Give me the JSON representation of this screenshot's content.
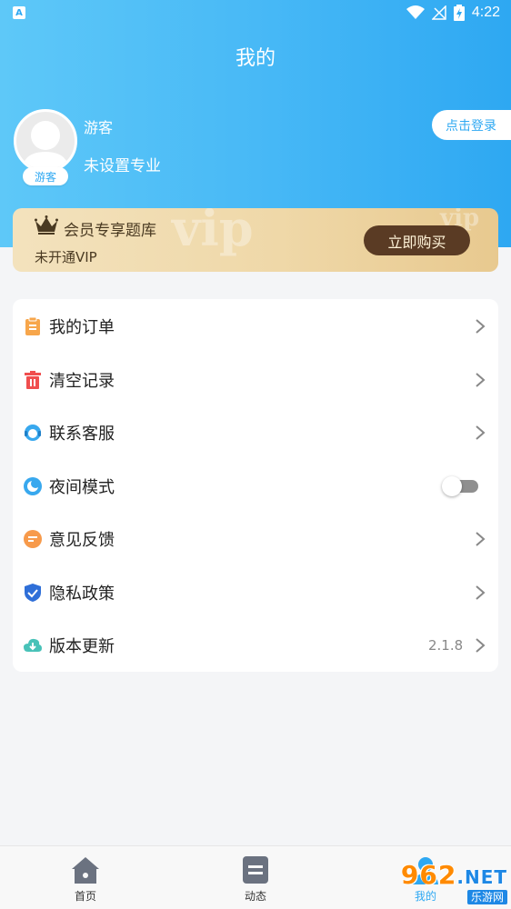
{
  "status_bar": {
    "notification_letter": "A",
    "time": "4:22",
    "icons": [
      "wifi-icon",
      "no-signal-icon",
      "battery-charging-icon"
    ]
  },
  "page": {
    "title": "我的"
  },
  "user": {
    "name": "游客",
    "major": "未设置专业",
    "avatar_badge": "游客",
    "login_label": "点击登录"
  },
  "vip": {
    "title": "会员专享题库",
    "status": "未开通VIP",
    "buy_label": "立即购买",
    "watermark": "vip",
    "colors": {
      "card": "#efd8a8",
      "button": "#5a3b24"
    }
  },
  "menu": [
    {
      "label": "我的订单",
      "icon": "order-icon",
      "accessory": "chevron"
    },
    {
      "label": "清空记录",
      "icon": "trash-icon",
      "accessory": "chevron"
    },
    {
      "label": "联系客服",
      "icon": "customer-service-icon",
      "accessory": "chevron"
    },
    {
      "label": "夜间模式",
      "icon": "night-mode-icon",
      "accessory": "toggle",
      "toggle_on": false
    },
    {
      "label": "意见反馈",
      "icon": "feedback-icon",
      "accessory": "chevron"
    },
    {
      "label": "隐私政策",
      "icon": "privacy-shield-icon",
      "accessory": "chevron"
    },
    {
      "label": "版本更新",
      "icon": "cloud-update-icon",
      "accessory": "chevron",
      "value": "2.1.8"
    }
  ],
  "bottom_nav": [
    {
      "label": "首页",
      "icon": "home-icon"
    },
    {
      "label": "动态",
      "icon": "news-icon"
    },
    {
      "label": "我的",
      "icon": "profile-icon",
      "active": true
    }
  ],
  "watermark_brand": {
    "number": "962",
    "suffix": ".NET",
    "sub": "乐游网"
  },
  "colors": {
    "accent": "#2ea8f2",
    "header_start": "#5ec8f8",
    "header_end": "#2ea8f2"
  }
}
